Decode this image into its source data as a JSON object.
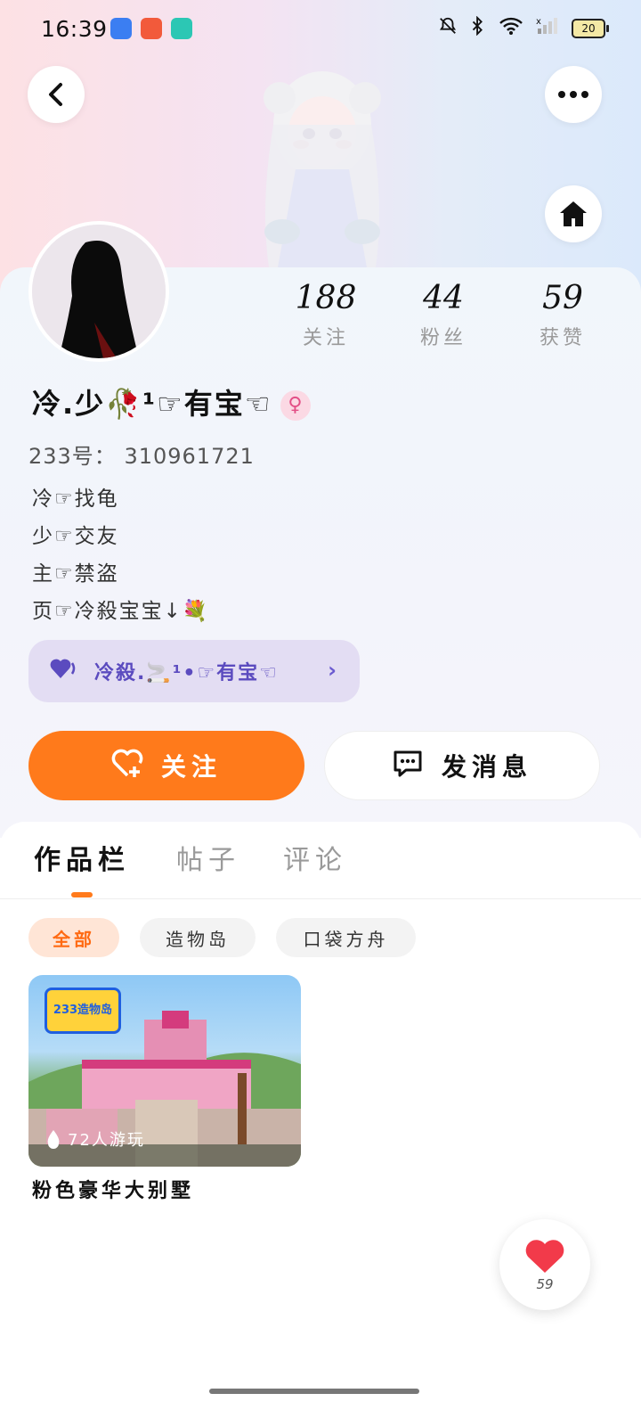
{
  "status_bar": {
    "time": "16:39",
    "battery": "20",
    "icons": [
      "message-app-icon",
      "shop-app-icon",
      "play-app-icon",
      "mute-icon",
      "bluetooth-icon",
      "wifi-icon",
      "signal-icon",
      "battery-icon"
    ]
  },
  "header": {
    "back_icon": "chevron-left-icon",
    "more_icon": "more-dots-icon",
    "home_icon": "home-icon"
  },
  "profile": {
    "stats": [
      {
        "value": "188",
        "label": "关注"
      },
      {
        "value": "44",
        "label": "粉丝"
      },
      {
        "value": "59",
        "label": "获赞"
      }
    ],
    "username": "冷.少🥀¹☞有宝☜",
    "gender": "♀",
    "uid_label": "233号：",
    "uid_value": "310961721",
    "bio": [
      "冷☞找龟",
      "少☞交友",
      "主☞禁盗",
      "页☞冷殺宝宝↓💐"
    ],
    "group_text": "冷殺.🚬¹•☞有宝☜"
  },
  "actions": {
    "follow_label": "关注",
    "message_label": "发消息"
  },
  "tabs": [
    "作品栏",
    "帖子",
    "评论"
  ],
  "chips": [
    "全部",
    "造物岛",
    "口袋方舟"
  ],
  "works": [
    {
      "logo_text": "233造物岛",
      "players": "72人游玩",
      "title": "粉色豪华大别墅"
    }
  ],
  "like_fab": {
    "count": "59"
  },
  "colors": {
    "accent": "#ff7a1b",
    "group_pill": "#e3ddf3",
    "gender_badge": "#e34f86"
  }
}
